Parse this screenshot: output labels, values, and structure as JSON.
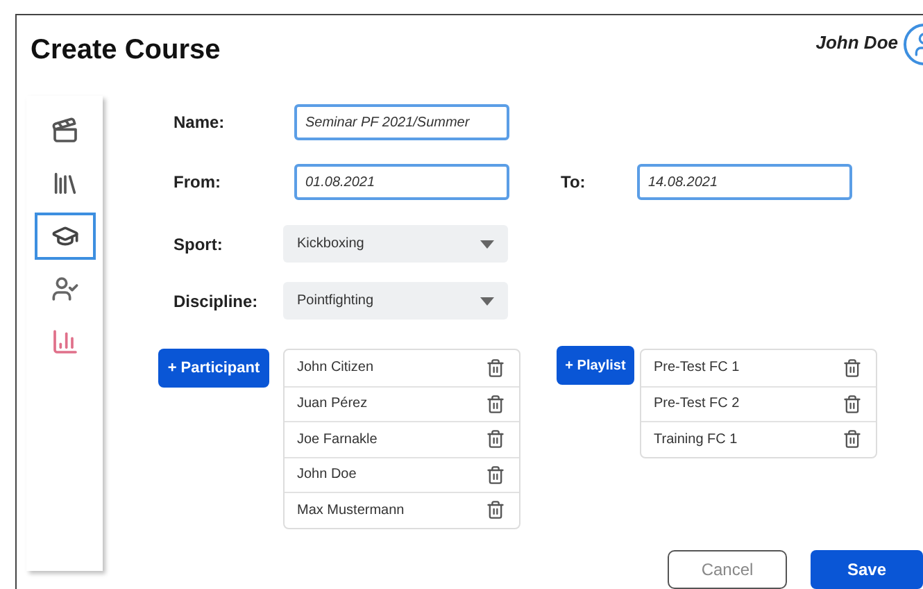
{
  "header": {
    "title": "Create Course",
    "user": "John Doe"
  },
  "sidebar": {
    "items": [
      {
        "kind": "clapperboard",
        "selected": false,
        "color": "#555555"
      },
      {
        "kind": "library",
        "selected": false,
        "color": "#555555"
      },
      {
        "kind": "course",
        "selected": true,
        "color": "#444444"
      },
      {
        "kind": "user-check",
        "selected": false,
        "color": "#666666"
      },
      {
        "kind": "chart",
        "selected": false,
        "color": "#e0708a"
      }
    ]
  },
  "form": {
    "name": {
      "label": "Name:",
      "value": "Seminar PF 2021/Summer"
    },
    "from": {
      "label": "From:",
      "value": "01.08.2021"
    },
    "to": {
      "label": "To:",
      "value": "14.08.2021"
    },
    "sport": {
      "label": "Sport:",
      "value": "Kickboxing"
    },
    "discipline": {
      "label": "Discipline:",
      "value": "Pointfighting"
    }
  },
  "participants": {
    "button": "+ Participant",
    "items": [
      "John Citizen",
      "Juan Pérez",
      "Joe Farnakle",
      "John Doe",
      "Max Mustermann"
    ]
  },
  "playlists": {
    "button": "+ Playlist",
    "items": [
      "Pre-Test FC 1",
      "Pre-Test FC 2",
      "Training FC 1"
    ]
  },
  "buttons": {
    "cancel": "Cancel",
    "save": "Save"
  }
}
